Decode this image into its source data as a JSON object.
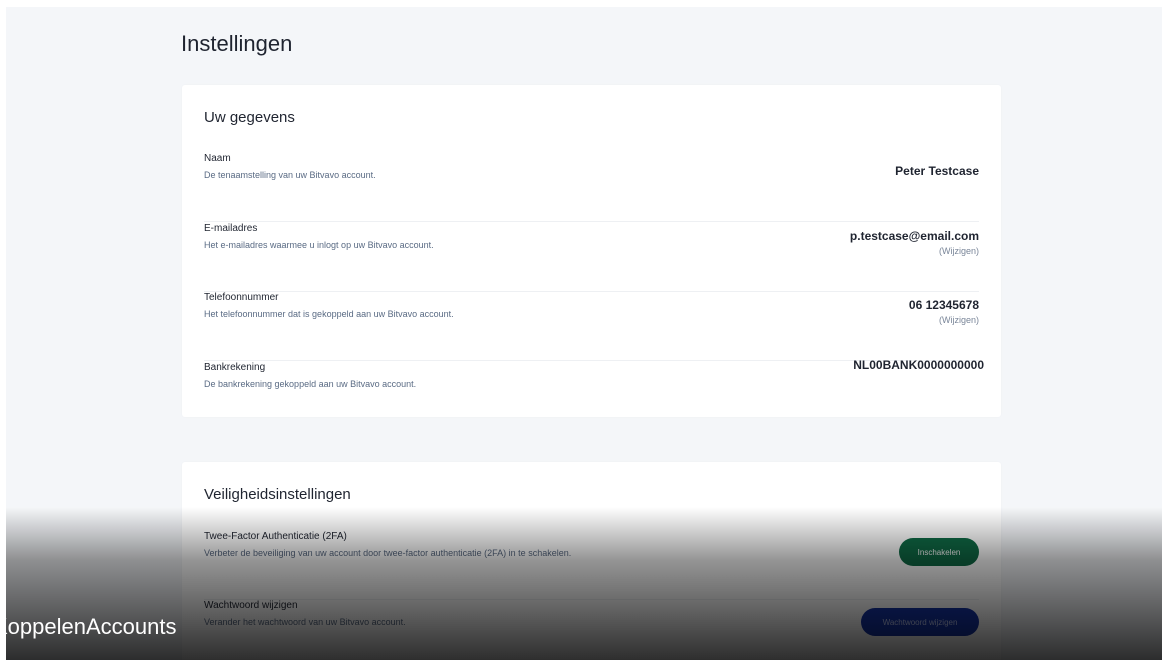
{
  "page": {
    "title": "Instellingen"
  },
  "personal": {
    "title": "Uw gegevens",
    "rows": [
      {
        "label": "Naam",
        "description": "De tenaamstelling van uw Bitvavo account.",
        "value": "Peter Testcase"
      },
      {
        "label": "E-mailadres",
        "description": "Het e-mailadres waarmee u inlogt op uw Bitvavo account.",
        "value": "p.testcase@email.com",
        "link": "(Wijzigen)"
      },
      {
        "label": "Telefoonnummer",
        "description": "Het telefoonnummer dat is gekoppeld aan uw Bitvavo account.",
        "value": "06 12345678",
        "link": "(Wijzigen)"
      },
      {
        "label": "Bankrekening",
        "description": "De bankrekening gekoppeld aan uw Bitvavo account.",
        "value": "NL00BANK0000000000"
      }
    ]
  },
  "security": {
    "title": "Veiligheidsinstellingen",
    "rows": [
      {
        "label": "Twee-Factor Authenticatie (2FA)",
        "description": "Verbeter de beveiliging van uw account door twee-factor authenticatie (2FA) in te schakelen.",
        "button": "Inschakelen"
      },
      {
        "label": "Wachtwoord wijzigen",
        "description": "Verander het wachtwoord van uw Bitvavo account.",
        "button": "Wachtwoord wijzigen"
      }
    ]
  },
  "overlay": {
    "watermark": "KoppelenAccounts"
  },
  "colors": {
    "background": "#f4f6f9",
    "card": "#ffffff",
    "primary_green": "#0f6b46",
    "primary_blue": "#1433a6",
    "muted_text": "#5a6b84"
  }
}
